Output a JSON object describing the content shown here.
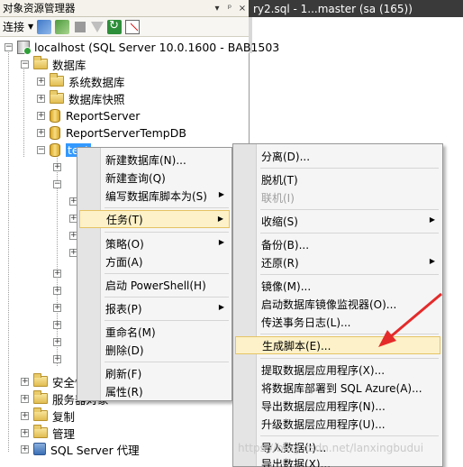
{
  "object_explorer": {
    "title": "对象资源管理器",
    "title_controls": [
      "▾",
      "ᵖ",
      "×"
    ],
    "toolbar": {
      "connect_label": "连接"
    }
  },
  "document_tab": {
    "title": "ry2.sql - 1...master (sa (165))"
  },
  "tree": {
    "server": "localhost (SQL Server 10.0.1600 - BAB1503",
    "databases": "数据库",
    "system_databases": "系统数据库",
    "db_snapshots": "数据库快照",
    "report_server": "ReportServer",
    "report_server_temp": "ReportServerTempDB",
    "selected_db": "test",
    "security": "安全性",
    "server_objects": "服务器对象",
    "replication": "复制",
    "management": "管理",
    "sql_agent": "SQL Server 代理"
  },
  "context_menu": {
    "items": [
      {
        "label": "新建数据库(N)...",
        "submenu": false
      },
      {
        "label": "新建查询(Q)",
        "submenu": false
      },
      {
        "label": "编写数据库脚本为(S)",
        "submenu": true
      },
      {
        "label": "任务(T)",
        "submenu": true
      },
      {
        "label": "策略(O)",
        "submenu": true
      },
      {
        "label": "方面(A)",
        "submenu": false
      },
      {
        "label": "启动 PowerShell(H)",
        "submenu": false
      },
      {
        "label": "报表(P)",
        "submenu": true
      },
      {
        "label": "重命名(M)",
        "submenu": false
      },
      {
        "label": "删除(D)",
        "submenu": false
      },
      {
        "label": "刷新(F)",
        "submenu": false
      },
      {
        "label": "属性(R)",
        "submenu": false
      }
    ]
  },
  "tasks_submenu": {
    "items": [
      {
        "label": "分离(D)...",
        "disabled": false,
        "submenu": false
      },
      {
        "label": "脱机(T)",
        "disabled": false,
        "submenu": false
      },
      {
        "label": "联机(I)",
        "disabled": true,
        "submenu": false
      },
      {
        "label": "收缩(S)",
        "disabled": false,
        "submenu": true
      },
      {
        "label": "备份(B)...",
        "disabled": false,
        "submenu": false
      },
      {
        "label": "还原(R)",
        "disabled": false,
        "submenu": true
      },
      {
        "label": "镜像(M)...",
        "disabled": false,
        "submenu": false
      },
      {
        "label": "启动数据库镜像监视器(O)...",
        "disabled": false,
        "submenu": false
      },
      {
        "label": "传送事务日志(L)...",
        "disabled": false,
        "submenu": false
      },
      {
        "label": "生成脚本(E)...",
        "disabled": false,
        "submenu": false
      },
      {
        "label": "提取数据层应用程序(X)...",
        "disabled": false,
        "submenu": false
      },
      {
        "label": "将数据库部署到 SQL Azure(A)...",
        "disabled": false,
        "submenu": false
      },
      {
        "label": "导出数据层应用程序(N)...",
        "disabled": false,
        "submenu": false
      },
      {
        "label": "升级数据层应用程序(U)...",
        "disabled": false,
        "submenu": false
      },
      {
        "label": "导入数据(I)...",
        "disabled": false,
        "submenu": false
      },
      {
        "label": "导出数据(X)...",
        "disabled": false,
        "submenu": false
      }
    ]
  },
  "watermark": "https://blog.csdn.net/lanxingbudui",
  "colors": {
    "selection": "#3399ff",
    "highlight": "#fcf1c8",
    "annotation": "#e52a2a"
  }
}
